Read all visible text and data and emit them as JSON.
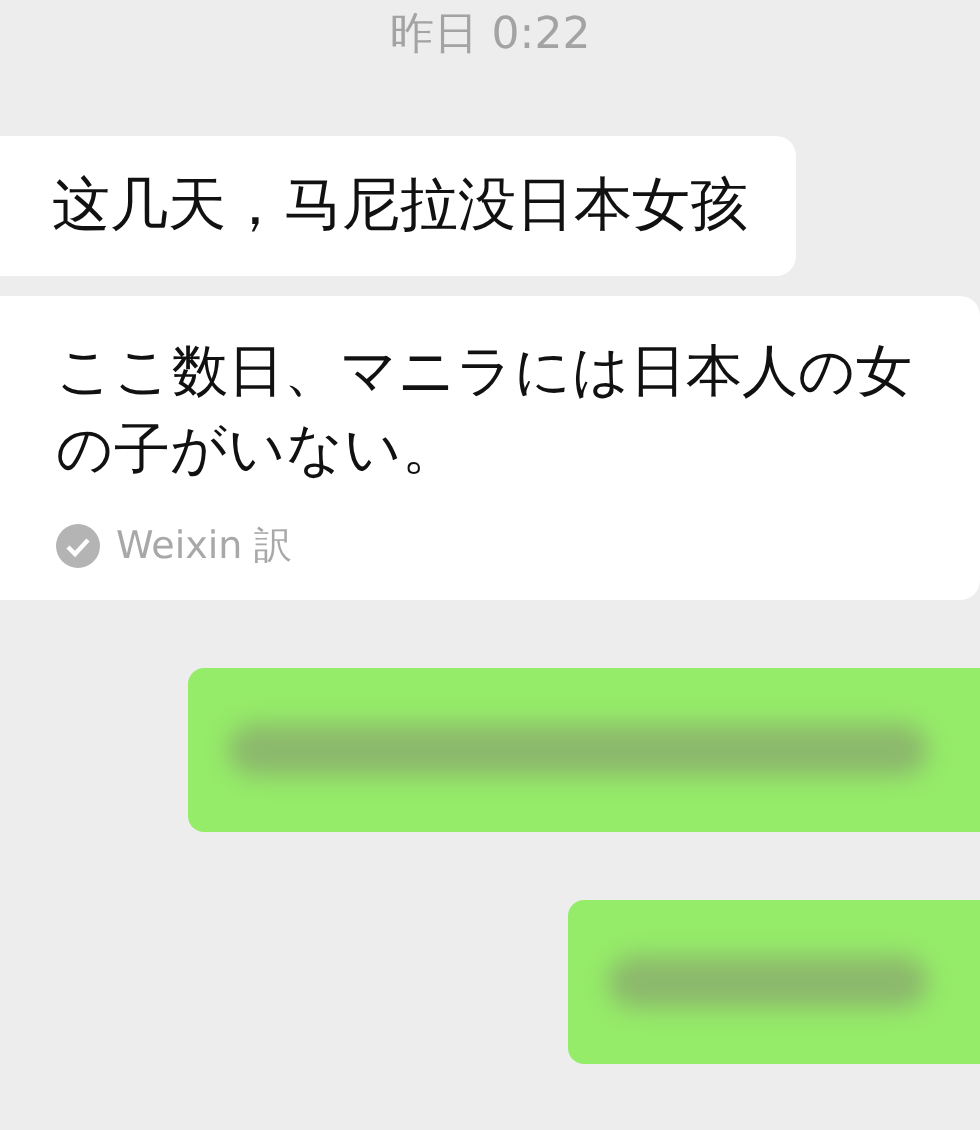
{
  "timestamp": "昨日 0:22",
  "messages": [
    {
      "kind": "received",
      "text": "这几天，马尼拉没日本女孩",
      "translation": {
        "text": "ここ数日、マニラには日本人の女の子がいない。",
        "source": "Weixin 訳"
      }
    },
    {
      "kind": "sent_wide"
    },
    {
      "kind": "sent_narrow"
    }
  ]
}
